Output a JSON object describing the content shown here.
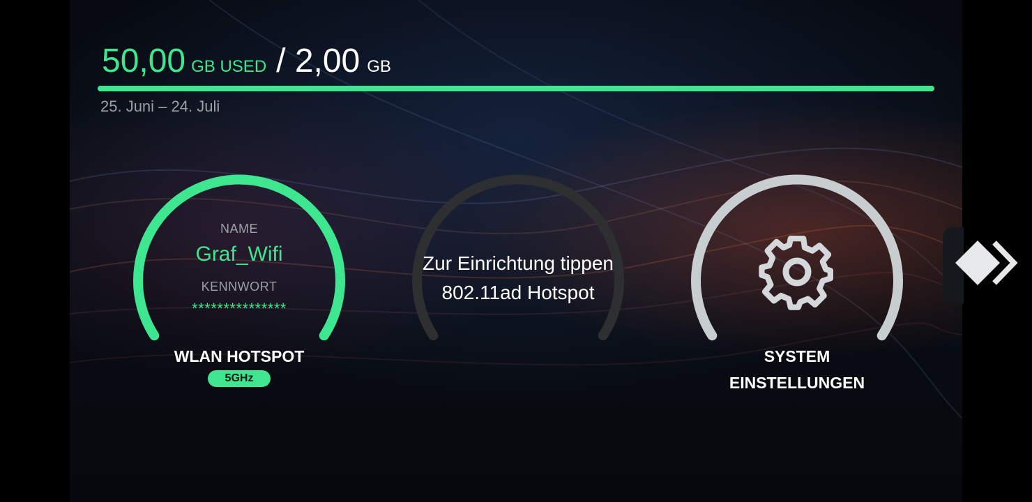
{
  "usage": {
    "used_value": "50,00",
    "used_unit": "GB USED",
    "total_value": "/ 2,00",
    "total_unit": "GB",
    "period": "25. Juni – 24. Juli",
    "fill_fraction": 1.0
  },
  "hotspot": {
    "name_label": "NAME",
    "name_value": "Graf_Wifi",
    "password_label": "KENNWORT",
    "password_value": "***************",
    "title": "WLAN HOTSPOT",
    "band": "5GHz"
  },
  "ad_hotspot": {
    "line1": "Zur Einrichtung tippen",
    "line2": "802.11ad Hotspot"
  },
  "system": {
    "title_line1": "SYSTEM",
    "title_line2": "EINSTELLUNGEN",
    "icon": "gear-icon"
  },
  "nav": {
    "next_icon": "next-page-icon"
  },
  "colors": {
    "accent": "#3ee68f",
    "arc_inactive": "#2e2f31",
    "arc_system": "#c8cdd0",
    "text": "#ffffff",
    "muted": "#9aa0a6"
  }
}
